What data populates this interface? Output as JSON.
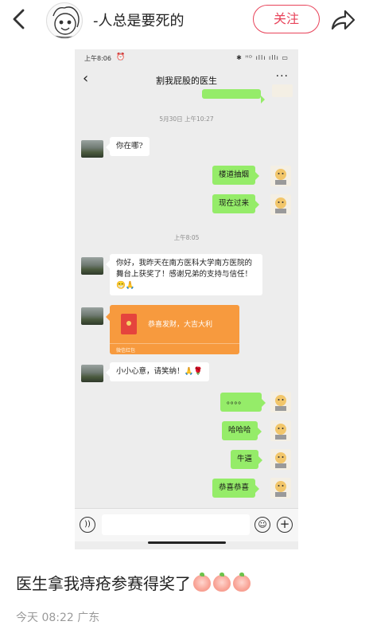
{
  "header": {
    "back_icon": "chevron-left-icon",
    "author_name": "-人总是要死的",
    "follow_label": "关注",
    "share_icon": "share-arrow-icon"
  },
  "screenshot": {
    "status_bar": {
      "time": "上午8:06",
      "alarm_icon": "alarm-clock-icon",
      "right_icons": "✱ ᴴᴰ ıllı ıllı ▭"
    },
    "chat_header": {
      "back_icon": "chevron-left-icon",
      "title": "割我屁股的医生",
      "more_icon": "more-dots-icon"
    },
    "timestamps": [
      "5月30日 上午10:27",
      "上午8:05"
    ],
    "messages": [
      {
        "side": "left",
        "text": "你在哪?"
      },
      {
        "side": "right",
        "text": "楼道抽烟"
      },
      {
        "side": "right",
        "text": "现在过来"
      },
      {
        "side": "left",
        "text": "你好，我昨天在南方医科大学南方医院的舞台上获奖了！感谢兄弟的支持与信任！😁🙏"
      },
      {
        "side": "left",
        "type": "red-packet",
        "text": "恭喜发财，大吉大利",
        "label": "微信红包"
      },
      {
        "side": "left",
        "text": "小小心意，请笑纳！🙏🌹"
      },
      {
        "side": "right",
        "text": "。。。。"
      },
      {
        "side": "right",
        "text": "哈哈哈"
      },
      {
        "side": "right",
        "text": "牛逼"
      },
      {
        "side": "right",
        "text": "恭喜恭喜"
      }
    ],
    "input_bar": {
      "voice_icon": "voice-icon",
      "emoji_icon": "emoji-icon",
      "plus_icon": "plus-circle-icon"
    }
  },
  "post": {
    "caption": "医生拿我痔疮参赛得奖了",
    "caption_emoji": [
      "peach-icon",
      "peach-icon",
      "peach-icon"
    ],
    "meta": "今天 08:22 广东"
  },
  "colors": {
    "follow_accent": "#e8435a",
    "chat_background": "#ededed",
    "sent_bubble": "#95ec69",
    "red_packet": "#f79a3e"
  }
}
